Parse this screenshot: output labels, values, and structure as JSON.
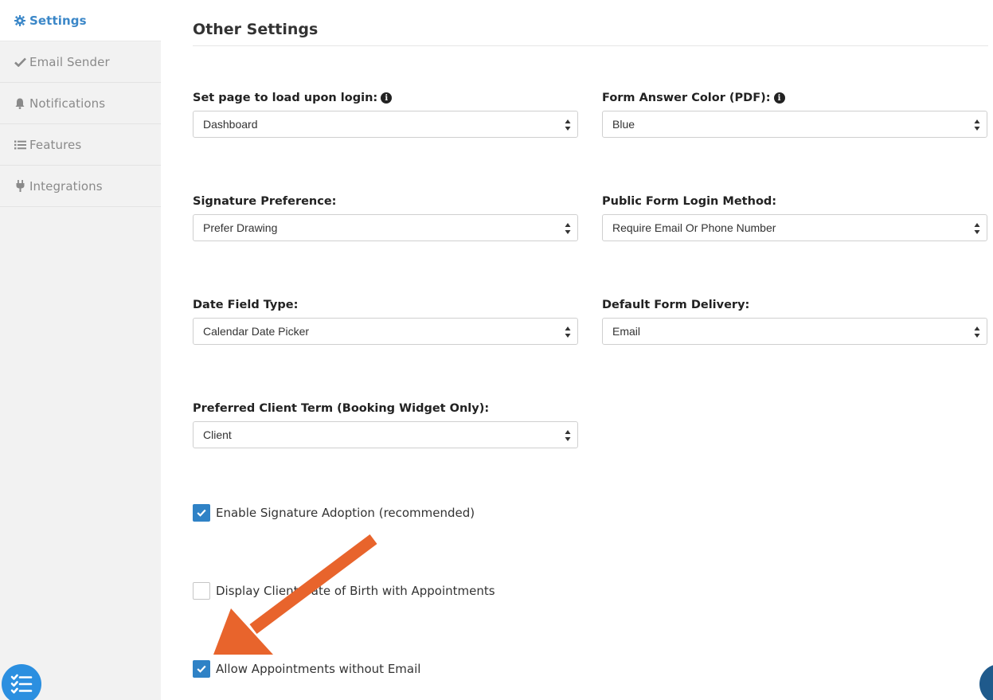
{
  "sidebar": {
    "items": [
      {
        "label": "Settings",
        "icon": "gear-icon",
        "active": true
      },
      {
        "label": "Email Sender",
        "icon": "check-icon",
        "active": false
      },
      {
        "label": "Notifications",
        "icon": "bell-icon",
        "active": false
      },
      {
        "label": "Features",
        "icon": "list-icon",
        "active": false
      },
      {
        "label": "Integrations",
        "icon": "plug-icon",
        "active": false
      }
    ]
  },
  "main": {
    "title": "Other Settings",
    "fields": {
      "login_page": {
        "label": "Set page to load upon login:",
        "value": "Dashboard"
      },
      "answer_color": {
        "label": "Form Answer Color (PDF):",
        "value": "Blue"
      },
      "signature_pref": {
        "label": "Signature Preference:",
        "value": "Prefer Drawing"
      },
      "login_method": {
        "label": "Public Form Login Method:",
        "value": "Require Email Or Phone Number"
      },
      "date_field": {
        "label": "Date Field Type:",
        "value": "Calendar Date Picker"
      },
      "form_delivery": {
        "label": "Default Form Delivery:",
        "value": "Email"
      },
      "client_term": {
        "label": "Preferred Client Term (Booking Widget Only):",
        "value": "Client"
      }
    },
    "checkboxes": {
      "signature_adoption": {
        "label": "Enable Signature Adoption (recommended)",
        "checked": true
      },
      "display_dob": {
        "label": "Display Client Date of Birth with Appointments",
        "checked": false
      },
      "allow_no_email": {
        "label": "Allow Appointments without Email",
        "checked": true
      }
    }
  },
  "colors": {
    "accent": "#3b87c8",
    "checkbox": "#2f82c6",
    "annotation_arrow": "#e8642c",
    "fab": "#2b8fe0"
  }
}
